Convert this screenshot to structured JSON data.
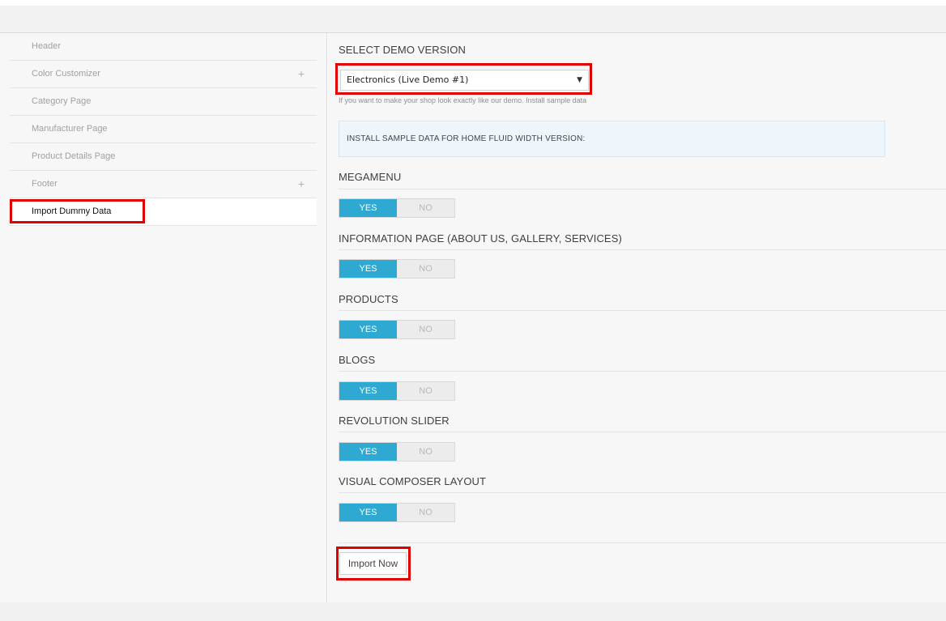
{
  "sidebar": {
    "items": [
      {
        "label": "Header",
        "has_plus": false
      },
      {
        "label": "Color Customizer",
        "has_plus": true
      },
      {
        "label": "Category Page",
        "has_plus": false
      },
      {
        "label": "Manufacturer Page",
        "has_plus": false
      },
      {
        "label": "Product Details Page",
        "has_plus": false
      },
      {
        "label": "Footer",
        "has_plus": true
      },
      {
        "label": "Import Dummy Data",
        "has_plus": false,
        "active": true
      }
    ],
    "plus_symbol": "+"
  },
  "main": {
    "demo_title": "SELECT DEMO VERSION",
    "demo_select": {
      "value": "Electronics (Live Demo #1)",
      "caret": "▼"
    },
    "demo_hint": "If you want to make your shop look exactly like our demo. Install sample data",
    "info_text": "INSTALL SAMPLE DATA FOR HOME FLUID WIDTH VERSION:",
    "options": [
      {
        "title": "MEGAMENU",
        "yes": "YES",
        "no": "NO",
        "selected": "YES"
      },
      {
        "title": "INFORMATION PAGE (ABOUT US, GALLERY, SERVICES)",
        "yes": "YES",
        "no": "NO",
        "selected": "YES"
      },
      {
        "title": "PRODUCTS",
        "yes": "YES",
        "no": "NO",
        "selected": "YES"
      },
      {
        "title": "BLOGS",
        "yes": "YES",
        "no": "NO",
        "selected": "YES"
      },
      {
        "title": "REVOLUTION SLIDER",
        "yes": "YES",
        "no": "NO",
        "selected": "YES"
      },
      {
        "title": "VISUAL COMPOSER LAYOUT",
        "yes": "YES",
        "no": "NO",
        "selected": "YES"
      }
    ],
    "import_button": "Import Now"
  },
  "colors": {
    "accent": "#2ea9d1",
    "highlight": "#e00000",
    "info_bg": "#eef6fc"
  }
}
